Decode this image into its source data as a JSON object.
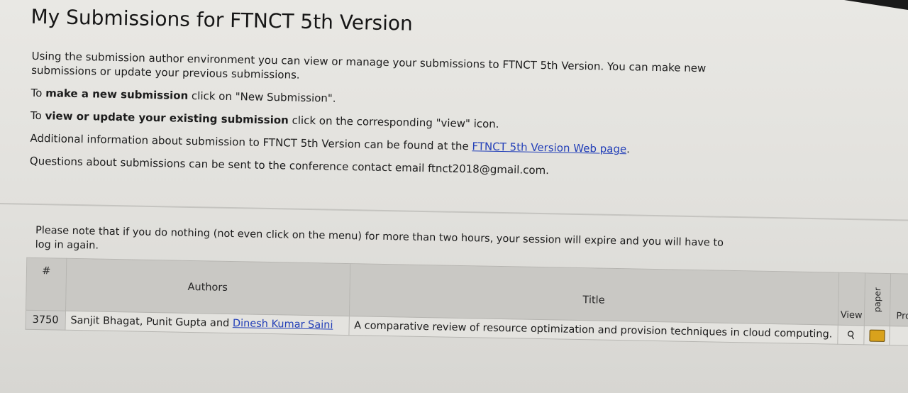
{
  "page": {
    "title": "My Submissions for FTNCT 5th Version",
    "intro": {
      "p1": "Using the submission author environment you can view or manage your submissions to FTNCT 5th Version. You can make new submissions or update your previous submissions.",
      "p2_before": "To ",
      "p2_bold": "make a new submission",
      "p2_after": " click on \"New Submission\".",
      "p3_before": "To ",
      "p3_bold": "view or update your existing submission",
      "p3_after": " click on the corresponding \"view\" icon.",
      "p4_before": "Additional information about submission to FTNCT 5th Version can be found at the ",
      "p4_link": "FTNCT 5th Version Web page",
      "p4_after": ".",
      "p5": "Questions about submissions can be sent to the conference contact email ftnct2018@gmail.com."
    },
    "session_note": "Please note that if you do nothing (not even click on the menu) for more than two hours, your session will expire and you will have to log in again."
  },
  "table": {
    "headers": {
      "num": "#",
      "authors": "Authors",
      "title": "Title",
      "view": "View",
      "paper": "paper",
      "pro": "Pro"
    },
    "rows": [
      {
        "num": "3750",
        "authors_plain": "Sanjit Bhagat, Punit Gupta and ",
        "authors_link": "Dinesh Kumar Saini",
        "title": "A comparative review of resource optimization and provision techniques in cloud computing."
      }
    ]
  },
  "icons": {
    "view": "magnifier-icon",
    "paper": "folder-icon"
  },
  "colors": {
    "link": "#2440b8",
    "header_bg": "#c9c8c4",
    "folder": "#d9a21c"
  }
}
